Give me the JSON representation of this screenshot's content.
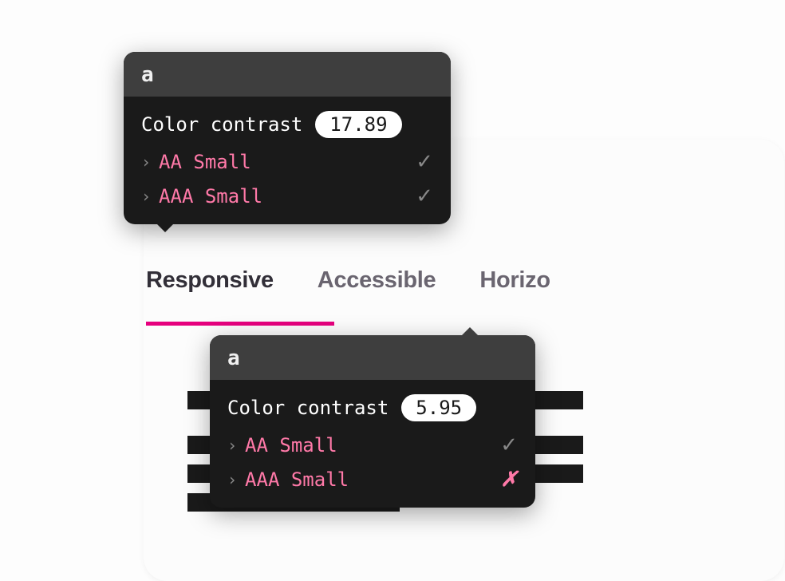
{
  "tabs": {
    "items": [
      {
        "label": "Responsive",
        "active": true
      },
      {
        "label": "Accessible",
        "active": false
      },
      {
        "label": "Horizo",
        "active": false
      }
    ]
  },
  "tooltips": [
    {
      "header_sample": "a",
      "contrast_label": "Color contrast",
      "contrast_value": "17.89",
      "checks": [
        {
          "label": "AA Small",
          "pass": true
        },
        {
          "label": "AAA Small",
          "pass": true
        }
      ]
    },
    {
      "header_sample": "a",
      "contrast_label": "Color contrast",
      "contrast_value": "5.95",
      "checks": [
        {
          "label": "AA Small",
          "pass": true
        },
        {
          "label": "AAA Small",
          "pass": false
        }
      ]
    }
  ],
  "colors": {
    "accent": "#e6007e",
    "tooltip_bg": "#1a1a1a",
    "tooltip_header": "#3e3e3e",
    "check_label": "#ff79a8",
    "check_pass": "#888",
    "check_fail": "#ff79a8"
  }
}
